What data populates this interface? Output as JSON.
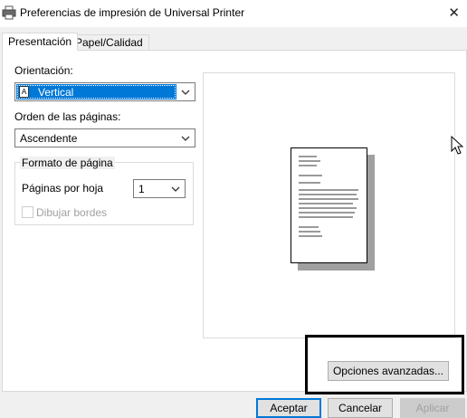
{
  "window": {
    "title": "Preferencias de impresión de Universal Printer",
    "close_glyph": "✕"
  },
  "tabs": [
    {
      "label": "Presentación",
      "active": true
    },
    {
      "label": "Papel/Calidad",
      "active": false
    }
  ],
  "layout": {
    "orientation_label": "Orientación:",
    "orientation_value": "Vertical",
    "page_order_label": "Orden de las páginas:",
    "page_order_value": "Ascendente",
    "page_format_title": "Formato de página",
    "pages_per_sheet_label": "Páginas por hoja",
    "pages_per_sheet_value": "1",
    "draw_borders_label": "Dibujar bordes",
    "draw_borders_checked": false,
    "orientation_icon_glyph": "A"
  },
  "buttons": {
    "advanced": "Opciones avanzadas...",
    "accept": "Aceptar",
    "cancel": "Cancelar",
    "apply": "Aplicar"
  },
  "colors": {
    "selection": "#0078d7",
    "default_button_border": "#0078d7"
  }
}
